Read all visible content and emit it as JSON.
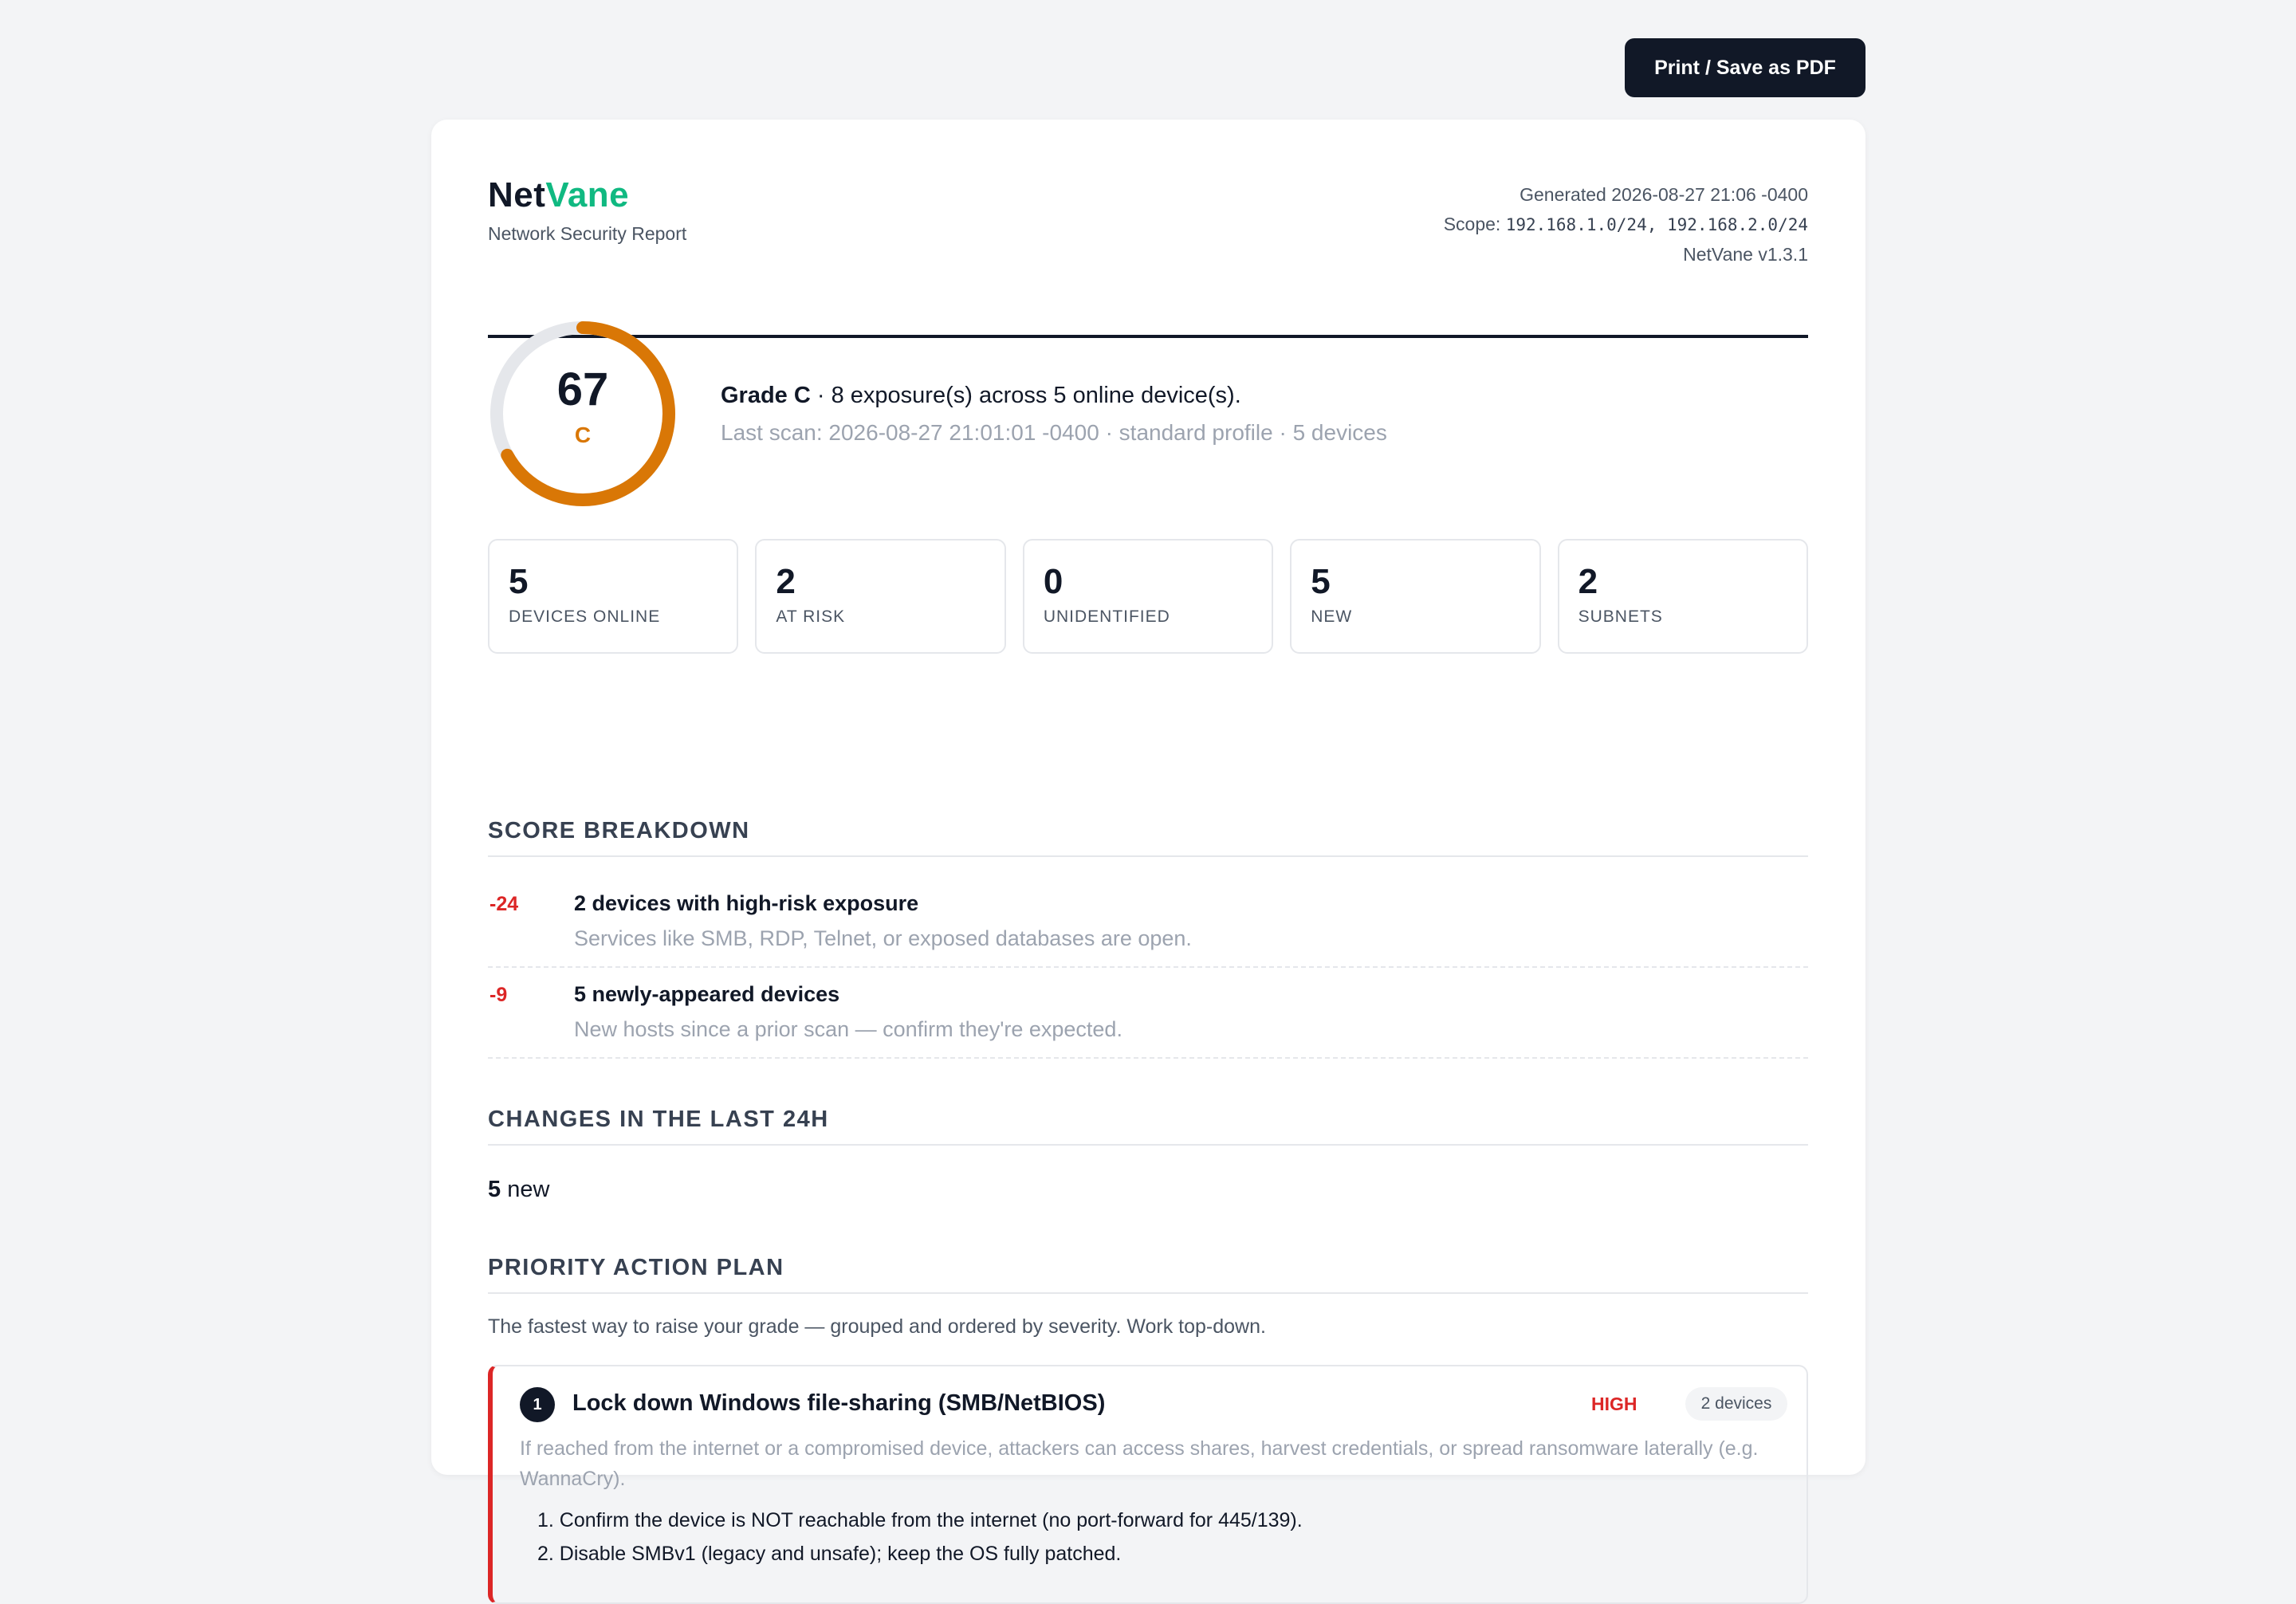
{
  "toolbar": {
    "print_label": "Print / Save as PDF"
  },
  "header": {
    "logo_part1": "Net",
    "logo_part2": "Vane",
    "subtitle": "Network Security Report",
    "generated": "Generated 2026-08-27 21:06 -0400",
    "scope_label": "Scope: ",
    "scope_value": "192.168.1.0/24, 192.168.2.0/24",
    "version": "NetVane v1.3.1"
  },
  "score": {
    "value": "67",
    "grade": "C",
    "gauge_fraction": 0.67,
    "grade_label": "Grade C",
    "summary_rest": " · 8 exposure(s) across 5 online device(s).",
    "last_scan": "Last scan: 2026-08-27 21:01:01 -0400 · standard profile · 5 devices",
    "accent_color": "#d97706"
  },
  "stats": [
    {
      "value": "5",
      "label": "DEVICES ONLINE"
    },
    {
      "value": "2",
      "label": "AT RISK"
    },
    {
      "value": "0",
      "label": "UNIDENTIFIED"
    },
    {
      "value": "5",
      "label": "NEW"
    },
    {
      "value": "2",
      "label": "SUBNETS"
    }
  ],
  "breakdown": {
    "title": "SCORE BREAKDOWN",
    "items": [
      {
        "points": "-24",
        "title": "2 devices with high-risk exposure",
        "desc": "Services like SMB, RDP, Telnet, or exposed databases are open."
      },
      {
        "points": "-9",
        "title": "5 newly-appeared devices",
        "desc": "New hosts since a prior scan — confirm they're expected."
      }
    ]
  },
  "changes": {
    "title": "CHANGES IN THE LAST 24H",
    "count": "5",
    "label": " new"
  },
  "plan": {
    "title": "PRIORITY ACTION PLAN",
    "intro": "The fastest way to raise your grade — grouped and ordered by severity. Work top-down.",
    "actions": [
      {
        "number": "1",
        "title": "Lock down Windows file-sharing (SMB/NetBIOS)",
        "severity": "HIGH",
        "devices": "2 devices",
        "desc": "If reached from the internet or a compromised device, attackers can access shares, harvest credentials, or spread ransomware laterally (e.g. WannaCry).",
        "steps": [
          "1. Confirm the device is NOT reachable from the internet (no port-forward for 445/139).",
          "2. Disable SMBv1 (legacy and unsafe); keep the OS fully patched."
        ]
      }
    ]
  }
}
